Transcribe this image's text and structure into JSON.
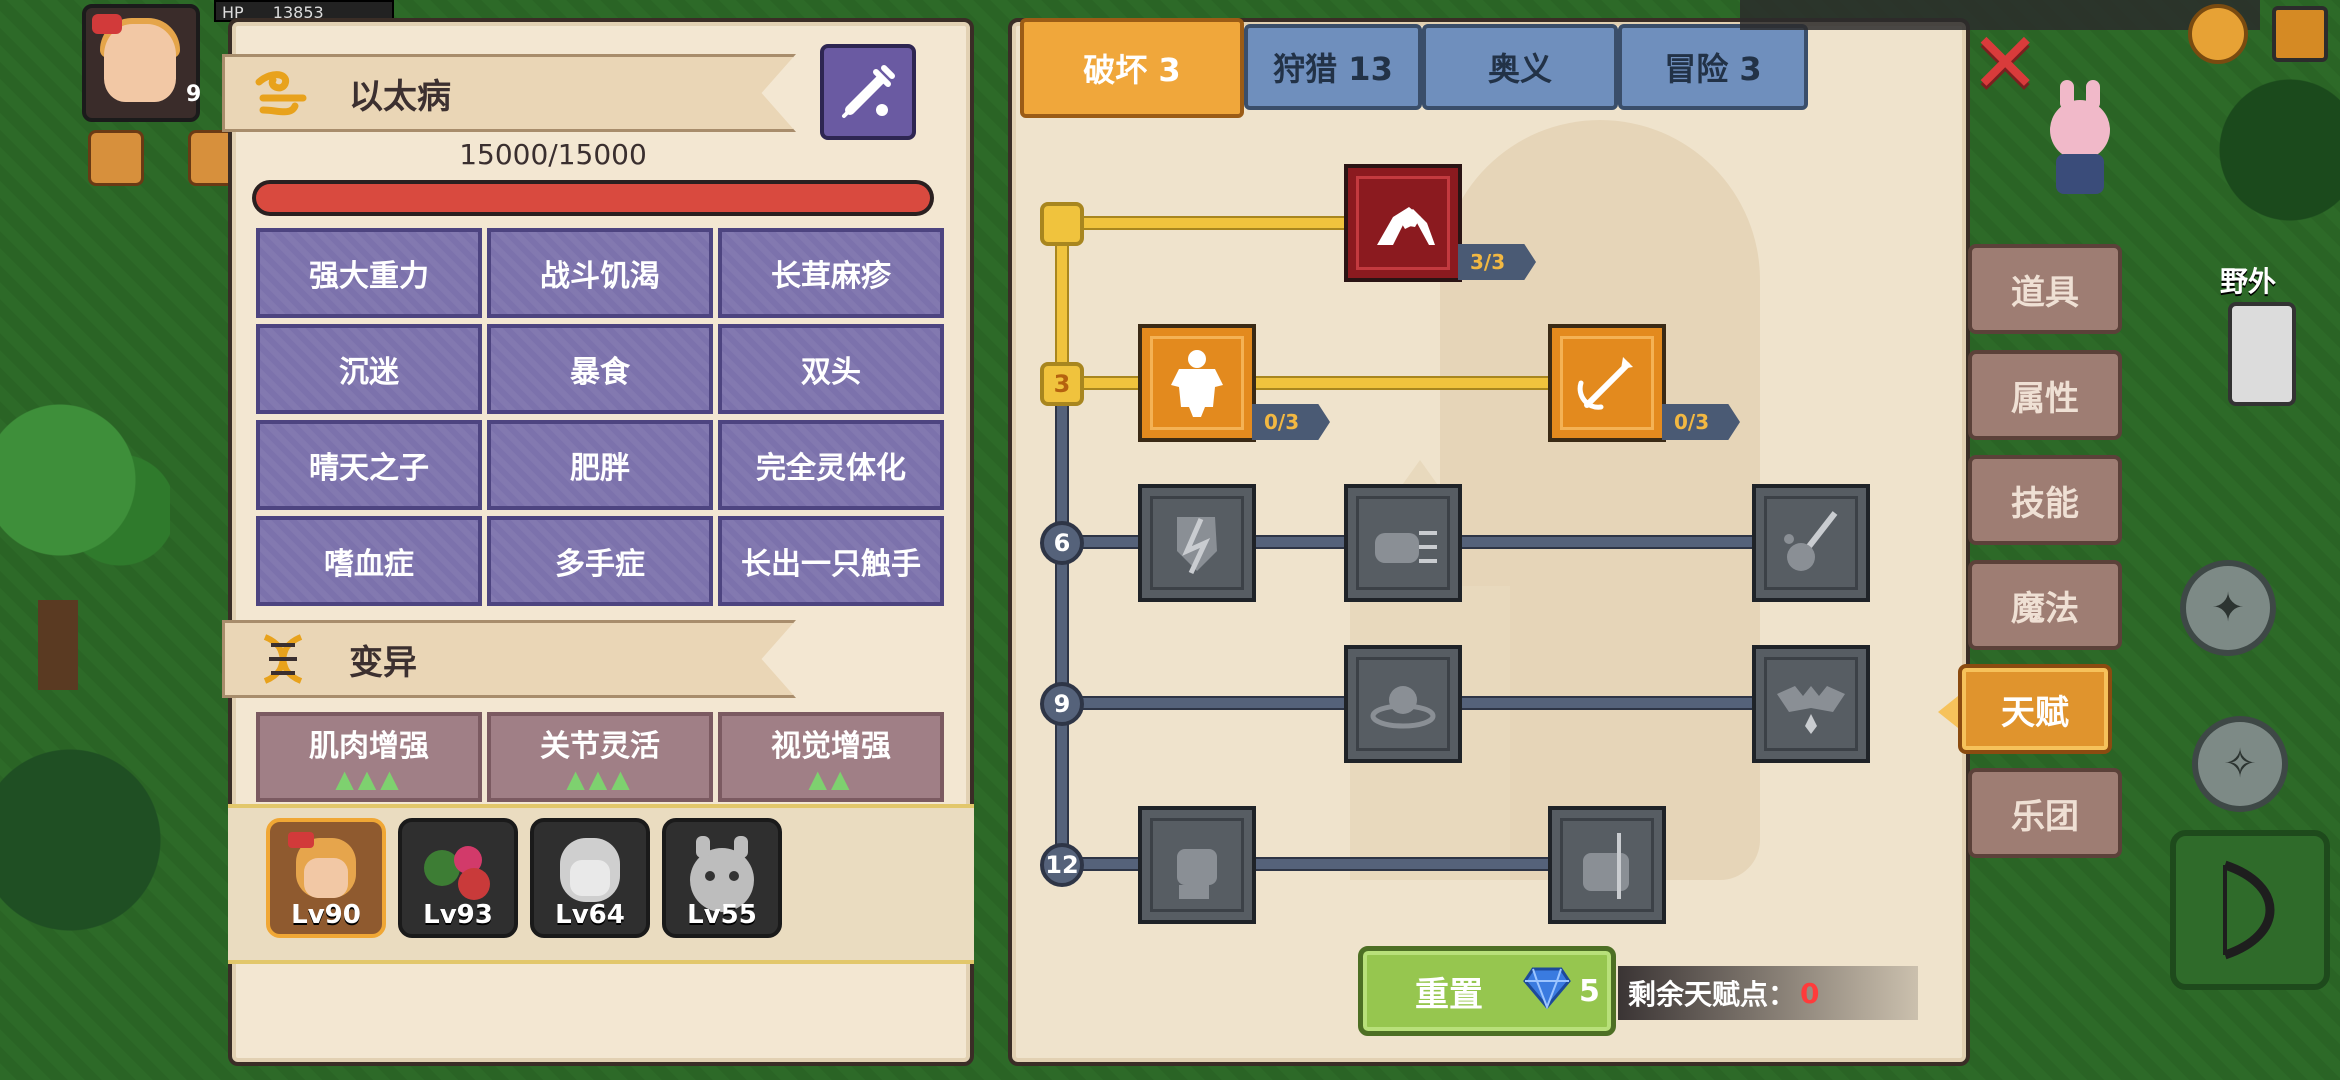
{
  "hud": {
    "hp_label": "HP",
    "hp_value": "13853",
    "level_hint": "9"
  },
  "disease": {
    "title": "以太病",
    "hp_text": "15000/15000",
    "hp_fraction": 1.0,
    "traits": [
      "强大重力",
      "战斗饥渴",
      "长茸麻疹",
      "沉迷",
      "暴食",
      "双头",
      "晴天之子",
      "肥胖",
      "完全灵体化",
      "嗜血症",
      "多手症",
      "长出一只触手"
    ]
  },
  "mutation": {
    "title": "变异",
    "items": [
      {
        "label": "肌肉增强",
        "stars": "▲▲▲"
      },
      {
        "label": "关节灵活",
        "stars": "▲▲▲"
      },
      {
        "label": "视觉增强",
        "stars": "▲▲"
      }
    ]
  },
  "team": [
    {
      "level": "Lv90",
      "selected": true
    },
    {
      "level": "Lv93",
      "selected": false
    },
    {
      "level": "Lv64",
      "selected": false
    },
    {
      "level": "Lv55",
      "selected": false
    }
  ],
  "tabs": [
    {
      "label": "破坏 3",
      "active": true
    },
    {
      "label": "狩猎 13",
      "active": false
    },
    {
      "label": "奥义",
      "active": false
    },
    {
      "label": "冒险 3",
      "active": false
    }
  ],
  "talent_tree": {
    "tiers": [
      "3",
      "6",
      "9",
      "12"
    ],
    "counts": {
      "arm_wrestle": "3/3",
      "body": "0/3",
      "arrow": "0/3"
    }
  },
  "reset": {
    "label": "重置",
    "cost": "5"
  },
  "remaining": {
    "label": "剩余天赋点：",
    "value": "0"
  },
  "side_menu": [
    "道具",
    "属性",
    "技能",
    "魔法",
    "天赋",
    "乐团"
  ],
  "side_active": "天赋",
  "field_label": "野外",
  "colors": {
    "active_tab": "#f0a73b",
    "tab": "#6f8fbd",
    "trait_tile": "#7c72ac",
    "mutation_tile": "#a07f86",
    "reset_button": "#96c64f",
    "zero_points": "#ff3b3b"
  }
}
